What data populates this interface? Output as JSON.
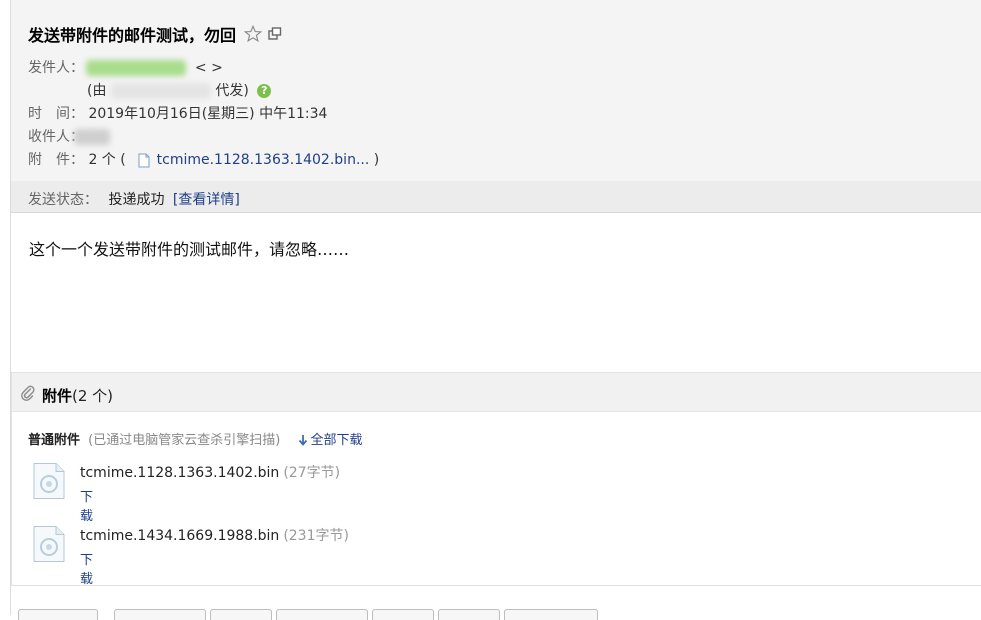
{
  "mail": {
    "subject": "发送带附件的邮件测试，勿回",
    "from_label": "发件人：",
    "from_suffix": "< >",
    "sent_by_prefix": "(由",
    "sent_by_suffix": "代发)",
    "time_label": "时　间：",
    "time_value": "2019年10月16日(星期三) 中午11:34",
    "to_label": "收件人：",
    "att_label": "附　件：",
    "att_count": "2 个",
    "att_first_name": "tcmime.1128.1363.1402.bin...",
    "status_label": "发送状态：",
    "status_value": "投递成功",
    "status_link": "[查看详情]",
    "body_text": "这个一个发送带附件的测试邮件，请忽略……"
  },
  "attachments": {
    "title": "附件",
    "count": "(2 个)",
    "section_label": "普通附件",
    "section_note": "(已通过电脑管家云查杀引擎扫描)",
    "download_all": "全部下载",
    "items": [
      {
        "name": "tcmime.1128.1363.1402.bin",
        "size": "(27字节)",
        "download": "下载"
      },
      {
        "name": "tcmime.1434.1669.1988.bin",
        "size": "(231字节)",
        "download": "下载"
      }
    ]
  },
  "icons": {
    "star": "star-icon",
    "popout": "popout-icon",
    "help": "help-icon",
    "file": "file-icon",
    "paperclip": "paperclip-icon",
    "download_arrow": "download-arrow-icon"
  },
  "colors": {
    "link": "#1f3f8a",
    "help_green": "#7cc04b",
    "header_bg": "#f4f4f4"
  }
}
